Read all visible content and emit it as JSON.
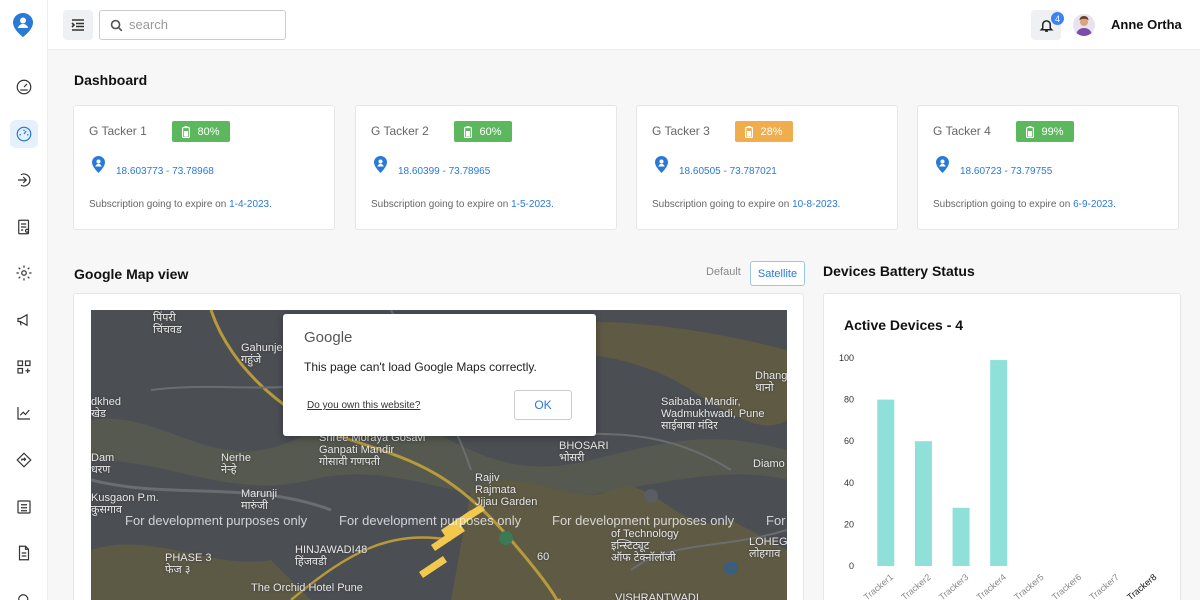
{
  "header": {
    "search_placeholder": "search",
    "notifications_count": "4",
    "user_name": "Anne Ortha"
  },
  "sidebar": {
    "items": [
      "dashboard-gauge-icon",
      "dashboard-icon",
      "login-icon",
      "report-icon",
      "settings-icon",
      "megaphone-icon",
      "apps-icon",
      "chart-icon",
      "direction-icon",
      "list-icon",
      "document-icon"
    ],
    "active_index": 1
  },
  "dashboard": {
    "title": "Dashboard",
    "subscription_prefix": "Subscription going to expire on",
    "trackers": [
      {
        "name": "G Tacker 1",
        "battery": "80%",
        "battery_color": "#5cb85c",
        "coords": "18.603773 - 73.78968",
        "expiry": "1-4-2023."
      },
      {
        "name": "G Tacker 2",
        "battery": "60%",
        "battery_color": "#5cb85c",
        "coords": "18.60399 - 73.78965",
        "expiry": "1-5-2023."
      },
      {
        "name": "G Tacker 3",
        "battery": "28%",
        "battery_color": "#f0ad4e",
        "coords": "18.60505 - 73.787021",
        "expiry": "10-8-2023."
      },
      {
        "name": "G Tacker 4",
        "battery": "99%",
        "battery_color": "#5cb85c",
        "coords": "18.60723 - 73.79755",
        "expiry": "6-9-2023."
      }
    ]
  },
  "map": {
    "title": "Google Map view",
    "toggle_default": "Default",
    "toggle_satellite": "Satellite",
    "watermark": "For development purposes only",
    "watermark_tail": "For",
    "dialog": {
      "brand": "Google",
      "message": "This page can't load Google Maps correctly.",
      "link": "Do you own this website?",
      "ok": "OK"
    },
    "places": [
      {
        "id": "p1",
        "text": "पिंपरी\nचिंचवड"
      },
      {
        "id": "p2",
        "text": "Gahunje\nगहुंजे"
      },
      {
        "id": "p3",
        "text": "Dhang\nधानो"
      },
      {
        "id": "p4",
        "text": "dkhed\nखेड"
      },
      {
        "id": "p5",
        "text": "Saibaba Mandir,\nWadmukhwadi, Pune\nसाईबाबा मंदिर"
      },
      {
        "id": "p6",
        "text": "Shree Moraya Gosavi\nGanpati Mandir\nगोसावी गणपती"
      },
      {
        "id": "p7",
        "text": "Nerhe\nनेऱ्हे"
      },
      {
        "id": "p8",
        "text": "Dam\nधरण"
      },
      {
        "id": "p9",
        "text": "BHOSARI\nभोसरी"
      },
      {
        "id": "p10",
        "text": "Diamo"
      },
      {
        "id": "p11",
        "text": "Marunji\nमारुंजी"
      },
      {
        "id": "p12",
        "text": "Kusgaon P.m.\nकुसगाव"
      },
      {
        "id": "p13",
        "text": "Rajiv\nRajmata\nJijau Garden"
      },
      {
        "id": "p14",
        "text": "of Technology\nइन्स्टिट्यूट\nऑफ टेक्नॉलॉजी"
      },
      {
        "id": "p15",
        "text": "HINJAWADI\nहिंजवडी"
      },
      {
        "id": "p16",
        "text": "PHASE 3\nफेज ३"
      },
      {
        "id": "p17",
        "text": "LOHEGAO\nलोहगाव"
      },
      {
        "id": "p18",
        "text": "The Orchid Hotel Pune"
      },
      {
        "id": "p19",
        "text": "VISHRANTWADI"
      },
      {
        "id": "p20",
        "text": "48"
      },
      {
        "id": "p21",
        "text": "60"
      }
    ]
  },
  "battery": {
    "title": "Devices Battery Status"
  },
  "chart_data": {
    "type": "bar",
    "title": "Active Devices - 4",
    "categories": [
      "Tracker1",
      "Tracker2",
      "Tracker3",
      "Tracker4",
      "Tracker5",
      "Tracker6",
      "Tracker7",
      "Tracker8"
    ],
    "values": [
      80,
      60,
      28,
      99,
      0,
      0,
      0,
      0
    ],
    "yticks": [
      "0",
      "20",
      "40",
      "60",
      "80",
      "100"
    ],
    "ylim": [
      0,
      100
    ],
    "bar_color": "#8ee0d8",
    "grid": false
  }
}
